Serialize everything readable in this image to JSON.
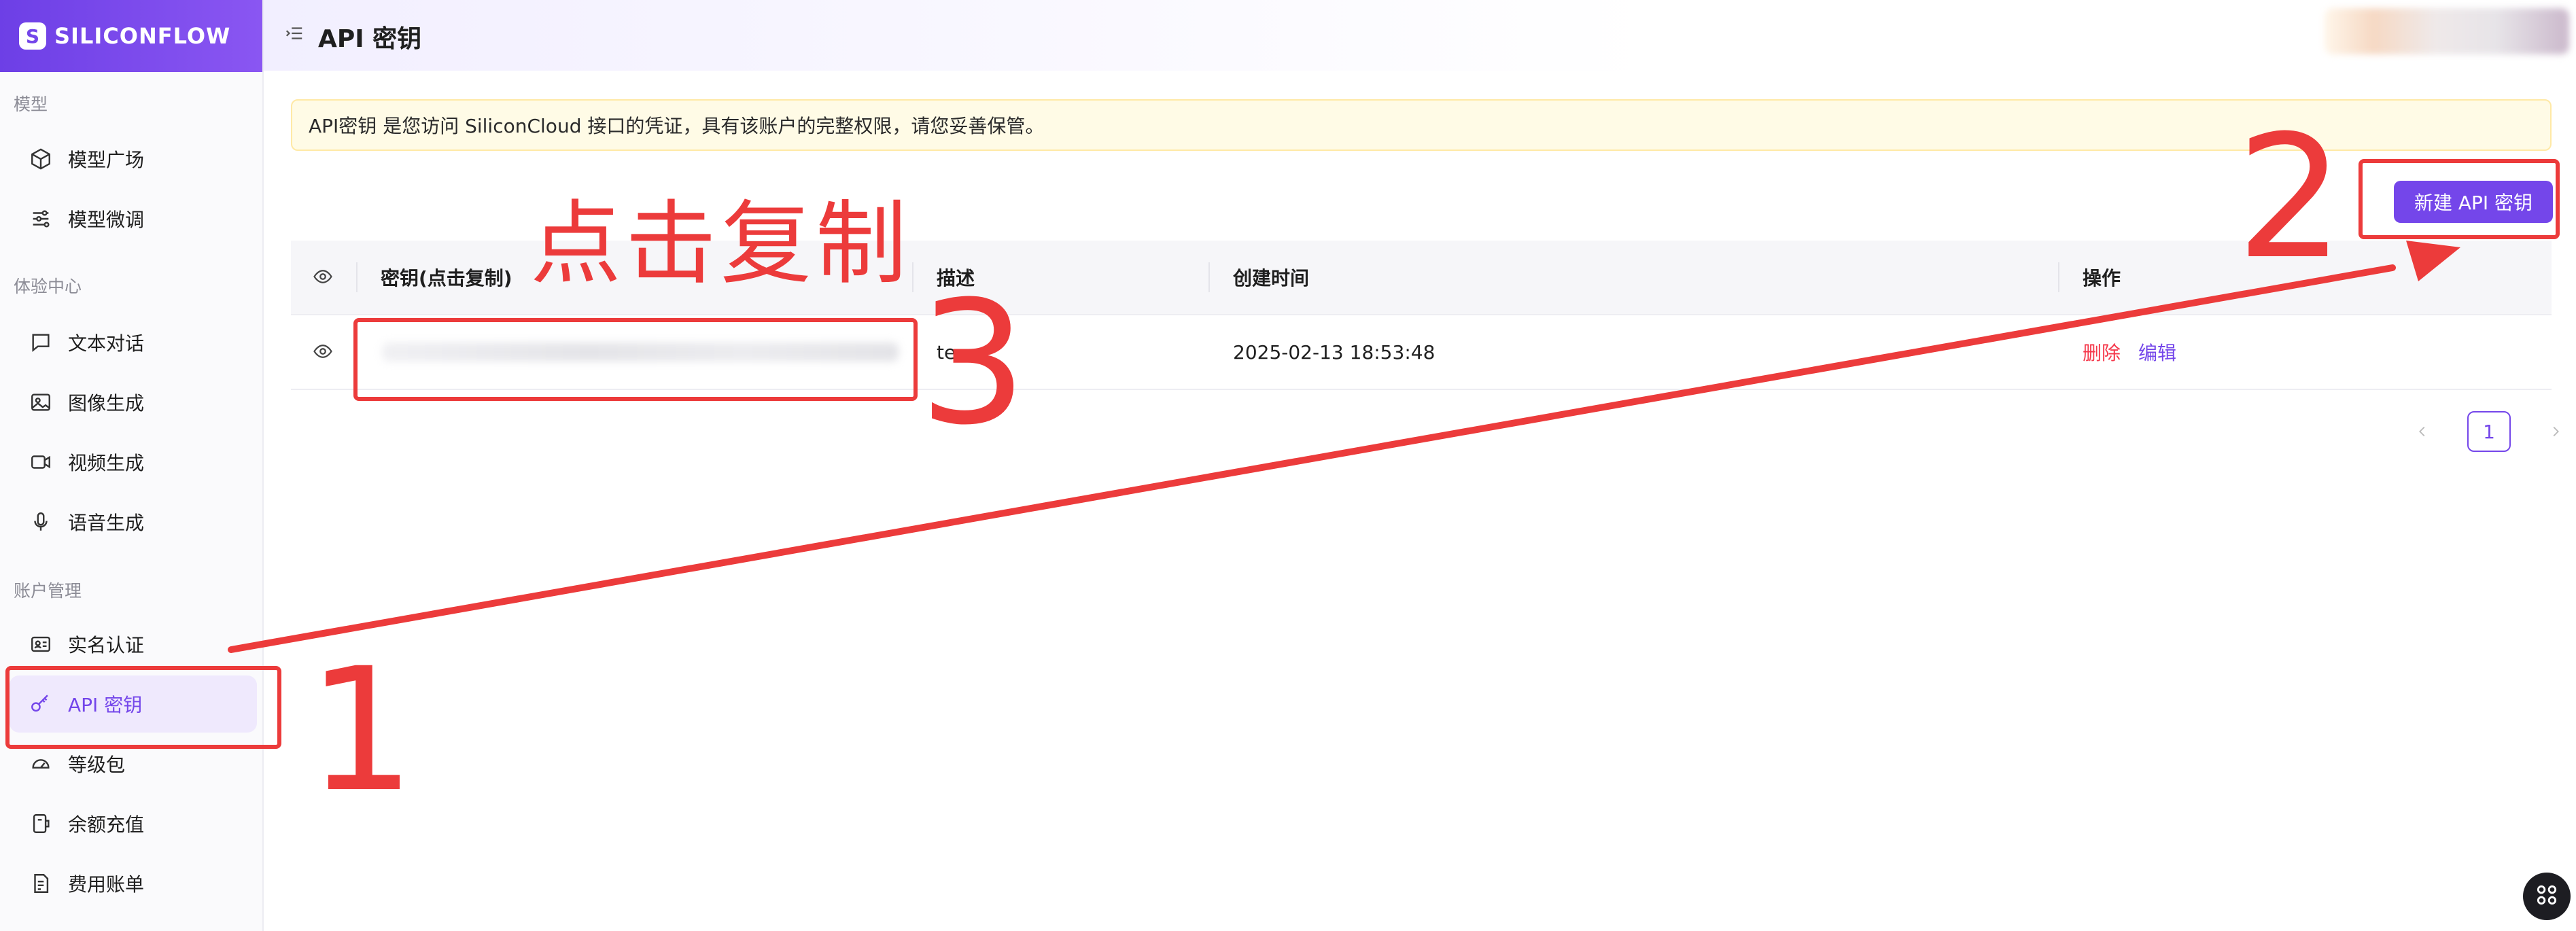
{
  "brand": {
    "logo_text": "SILICONFLOW"
  },
  "sidebar": {
    "sections": [
      {
        "label": "模型"
      },
      {
        "label": "体验中心"
      },
      {
        "label": "账户管理"
      }
    ],
    "items": [
      {
        "label": "模型广场",
        "icon": "cube-icon"
      },
      {
        "label": "模型微调",
        "icon": "sliders-icon"
      },
      {
        "label": "文本对话",
        "icon": "chat-icon"
      },
      {
        "label": "图像生成",
        "icon": "image-icon"
      },
      {
        "label": "视频生成",
        "icon": "video-icon"
      },
      {
        "label": "语音生成",
        "icon": "microphone-icon"
      },
      {
        "label": "实名认证",
        "icon": "id-card-icon"
      },
      {
        "label": "API 密钥",
        "icon": "key-icon"
      },
      {
        "label": "等级包",
        "icon": "gauge-icon"
      },
      {
        "label": "余额充值",
        "icon": "wallet-icon"
      },
      {
        "label": "费用账单",
        "icon": "bill-icon"
      }
    ],
    "active_index": 7
  },
  "header": {
    "title": "API 密钥"
  },
  "notice": {
    "text": "API密钥 是您访问 SiliconCloud 接口的凭证，具有该账户的完整权限，请您妥善保管。"
  },
  "actions": {
    "create_label": "新建 API 密钥"
  },
  "table": {
    "columns": [
      "密钥(点击复制)",
      "描述",
      "创建时间",
      "操作"
    ],
    "rows": [
      {
        "description": "te",
        "created": "2025-02-13 18:53:48",
        "delete": "删除",
        "edit": "编辑"
      }
    ]
  },
  "pagination": {
    "current": "1"
  },
  "annotations": {
    "step1": "1",
    "step2": "2",
    "step3": "3",
    "copy_hint": "点击复制"
  },
  "colors": {
    "accent": "#7446ea",
    "danger": "#f5384b",
    "annotation": "#ec3b3b",
    "notice_bg": "#fffbe6"
  }
}
